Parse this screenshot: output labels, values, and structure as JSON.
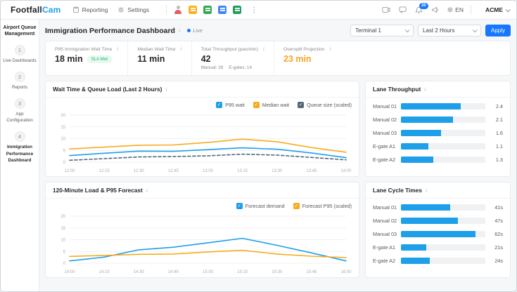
{
  "topbar": {
    "logo_part1": "Footfall",
    "logo_part2": "Cam",
    "nav": [
      {
        "label": "Reporting",
        "icon": "reporting-icon"
      },
      {
        "label": "Settings",
        "icon": "gear-icon"
      }
    ],
    "app_icons": [
      "person-app-icon",
      "sheet-yellow-app-icon",
      "sheet-green-app-icon",
      "board-blue-app-icon",
      "calendar-green-app-icon"
    ],
    "right_icons": [
      "video-icon",
      "chat-icon",
      "bell-icon",
      "megaphone-icon"
    ],
    "notification_count": "20",
    "language": "EN",
    "account": "ACME"
  },
  "sidebar": {
    "title": "Airport Queue Management",
    "items": [
      {
        "number": "1",
        "label": "Live Dashboards",
        "active": false
      },
      {
        "number": "2",
        "label": "Reports",
        "active": false
      },
      {
        "number": "3",
        "label": "App Configuration",
        "active": false
      },
      {
        "number": "4",
        "label": "Immigration Performance Dashboard",
        "active": true
      }
    ]
  },
  "page": {
    "title": "Immigration Performance Dashboard",
    "live_label": "Live",
    "terminal_select": "Terminal 1",
    "range_select": "Last 2 Hours",
    "apply_label": "Apply"
  },
  "kpis": [
    {
      "label": "P95 Immigration Wait Time",
      "value": "18 min",
      "badge": "SLA Met"
    },
    {
      "label": "Median Wait Time",
      "value": "11 min"
    },
    {
      "label": "Total Throughput (pax/min)",
      "value": "42",
      "sub": [
        "Manual: 28",
        "E-gates: 14"
      ]
    },
    {
      "label": "Overspill Projection",
      "value": "23 min",
      "value_color": "#f5a623"
    }
  ],
  "colors": {
    "blue": "#1e9fe9",
    "orange": "#f8ab1d",
    "slate": "#51677a",
    "accent": "#1777ff",
    "green_badge": "#2bb673"
  },
  "chart_data": [
    {
      "type": "line",
      "title": "Wait Time & Queue Load (Last 2 Hours)",
      "x": [
        "12:00",
        "12:15",
        "12:30",
        "12:45",
        "13:00",
        "13:15",
        "13:30",
        "13:45",
        "14:00"
      ],
      "ylim": [
        0,
        20
      ],
      "yticks": [
        0,
        5,
        10,
        15,
        20
      ],
      "grid": true,
      "legend_position": "top-right",
      "series": [
        {
          "name": "P95 wait",
          "color": "#1e9fe9",
          "dashed": false,
          "values": [
            2.8,
            3.8,
            4.7,
            4.6,
            5.3,
            6.1,
            5.5,
            3.9,
            1.9
          ]
        },
        {
          "name": "Median wait",
          "color": "#f8ab1d",
          "dashed": false,
          "values": [
            5.6,
            6.4,
            7.2,
            7.3,
            8.4,
            9.8,
            8.7,
            6.2,
            4.2
          ]
        },
        {
          "name": "Queue size (scaled)",
          "color": "#51677a",
          "dashed": true,
          "values": [
            0.8,
            1.5,
            2.2,
            2.4,
            2.7,
            3.4,
            3.0,
            2.0,
            1.0
          ]
        }
      ]
    },
    {
      "type": "bar",
      "title": "Lane Throughput",
      "categories": [
        "Manual 01",
        "Manual 02",
        "Manual 03",
        "E-gate A1",
        "E-gate A2"
      ],
      "values": [
        2.4,
        2.1,
        1.6,
        1.1,
        1.3
      ],
      "value_labels": [
        "2.4",
        "2.1",
        "1.6",
        "1.1",
        "1.3"
      ],
      "bar_scale_max": 3.4,
      "bar_color": "#1e9fe9"
    },
    {
      "type": "line",
      "title": "120-Minute Load & P95 Forecast",
      "x": [
        "14:00",
        "14:15",
        "14:30",
        "14:45",
        "15:00",
        "15:15",
        "15:30",
        "15:45",
        "16:00"
      ],
      "ylim": [
        0,
        20
      ],
      "yticks": [
        0,
        5,
        10,
        15,
        20
      ],
      "grid": true,
      "legend_position": "top-right",
      "series": [
        {
          "name": "Forecast demand",
          "color": "#1e9fe9",
          "dashed": false,
          "values": [
            1.0,
            2.6,
            5.7,
            6.8,
            8.7,
            10.6,
            7.6,
            4.4,
            1.0
          ]
        },
        {
          "name": "Forecast P95 (scaled)",
          "color": "#f8ab1d",
          "dashed": false,
          "values": [
            2.9,
            3.3,
            3.8,
            3.9,
            4.8,
            5.5,
            3.9,
            3.0,
            2.4
          ]
        }
      ]
    },
    {
      "type": "bar",
      "title": "Lane Cycle Times",
      "categories": [
        "Manual 01",
        "Manual 02",
        "Manual 03",
        "E-gate A1",
        "E-gate A2"
      ],
      "values": [
        41,
        47,
        62,
        21,
        24
      ],
      "value_labels": [
        "41s",
        "47s",
        "62s",
        "21s",
        "24s"
      ],
      "bar_scale_max": 70,
      "bar_color": "#1e9fe9"
    }
  ]
}
